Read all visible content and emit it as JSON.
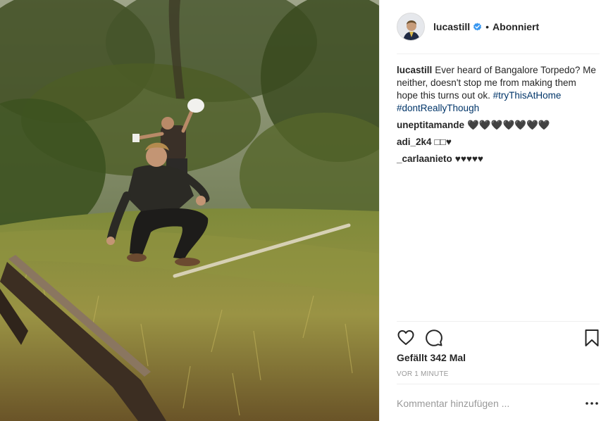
{
  "post": {
    "photo_icon": "photo-forest-railway",
    "author": {
      "username": "lucastill",
      "verified_icon": "verified-badge-icon",
      "dot": "•",
      "follow_state": "Abonniert"
    },
    "caption": {
      "username": "lucastill",
      "text": "Ever heard of Bangalore Torpedo? Me neither, doesn't stop me from making them hope this turns out ok.",
      "hashtags": [
        "#tryThisAtHome",
        "#dontReallyThough"
      ]
    },
    "comments": [
      {
        "username": "uneptitamande",
        "text": "🖤🖤🖤🖤🖤🖤🖤"
      },
      {
        "username": "adi_2k4",
        "text": "□□♥"
      },
      {
        "username": "_carlaanieto",
        "text": "♥♥♥♥♥"
      }
    ],
    "likes": "Gefällt 342 Mal",
    "timestamp": "VOR 1 MINUTE",
    "comment_placeholder": "Kommentar hinzufügen ...",
    "more_label": "•••"
  },
  "colors": {
    "hashtag": "#003569",
    "verified": "#3897f0",
    "muted": "#999999",
    "divider": "#efefef"
  }
}
